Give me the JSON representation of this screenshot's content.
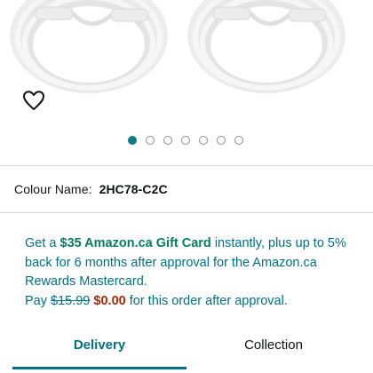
{
  "gallery": {
    "image_alt": "two coiled white USB-C cables",
    "favourite_icon": "heart-outline-icon",
    "dot_count": 7,
    "active_index": 0
  },
  "colour": {
    "label": "Colour Name:",
    "value": "2HC78-C2C"
  },
  "promo": {
    "line_get": "Get a ",
    "gift_card": "$35 Amazon.ca Gift Card",
    "line_rest": " instantly, plus up to 5% back for 6 months after approval for the Amazon.ca Rewards Mastercard.",
    "pay_label": "Pay ",
    "original_price": "$15.99",
    "new_price": "$0.00",
    "pay_rest": " for this order after approval."
  },
  "tabs": {
    "delivery": "Delivery",
    "collection": "Collection",
    "active": "delivery"
  },
  "colors": {
    "accent": "#007185",
    "green": "#067D62",
    "price_red": "#B12704"
  }
}
